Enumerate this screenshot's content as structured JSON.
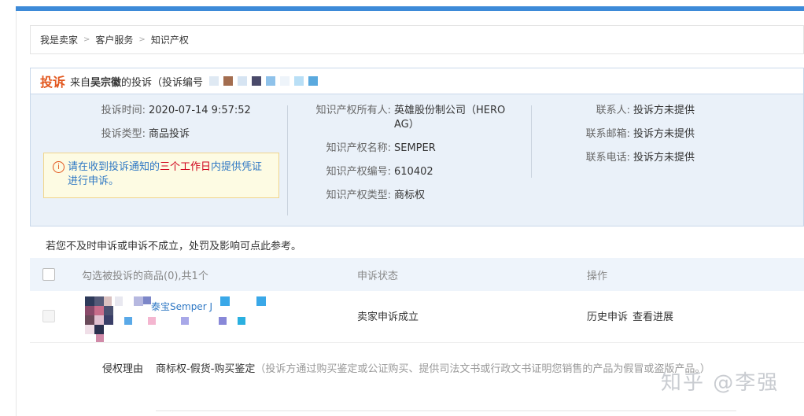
{
  "breadcrumb": {
    "items": [
      "我是卖家",
      "客户服务",
      "知识产权"
    ]
  },
  "header": {
    "tag": "投诉",
    "from_prefix": "来自",
    "from_name": "吴宗徽",
    "suffix": "的投诉（投诉编号"
  },
  "details": {
    "time_label": "投诉时间:",
    "time_value": "2020-07-14 9:57:52",
    "type_label": "投诉类型:",
    "type_value": "商品投诉",
    "owner_label": "知识产权所有人:",
    "owner_value": "英雄股份制公司（HERO AG）",
    "ipname_label": "知识产权名称:",
    "ipname_value": "SEMPER",
    "ipno_label": "知识产权编号:",
    "ipno_value": "610402",
    "iptype_label": "知识产权类型:",
    "iptype_value": "商标权",
    "contact_label": "联系人:",
    "contact_value": "投诉方未提供",
    "email_label": "联系邮箱:",
    "email_value": "投诉方未提供",
    "phone_label": "联系电话:",
    "phone_value": "投诉方未提供"
  },
  "notice": {
    "before": "请在收到投诉通知的",
    "highlight": "三个工作日",
    "after": "内提供凭证进行申诉。"
  },
  "hint": "若您不及时申诉或申诉不成立，处罚及影响可点此参考。",
  "table": {
    "headers": [
      "勾选被投诉的商品(0),共1个",
      "申诉状态",
      "操作"
    ],
    "row": {
      "product_text": "泰宝Semper J",
      "status": "卖家申诉成立",
      "action1": "历史申诉",
      "action2": "查看进展"
    }
  },
  "reason": {
    "label": "侵权理由",
    "value": "商标权-假货-购买鉴定",
    "desc": "（投诉方通过购买鉴定或公证购买、提供司法文书或行政文书证明您销售的产品为假冒或盗版产品。）"
  },
  "watermark": "知乎 @李强",
  "colors": {
    "accent": "#e2571e",
    "topbar": "#3d8ad8",
    "panel_bg": "#eaf1f9",
    "link": "#2f78c4"
  }
}
